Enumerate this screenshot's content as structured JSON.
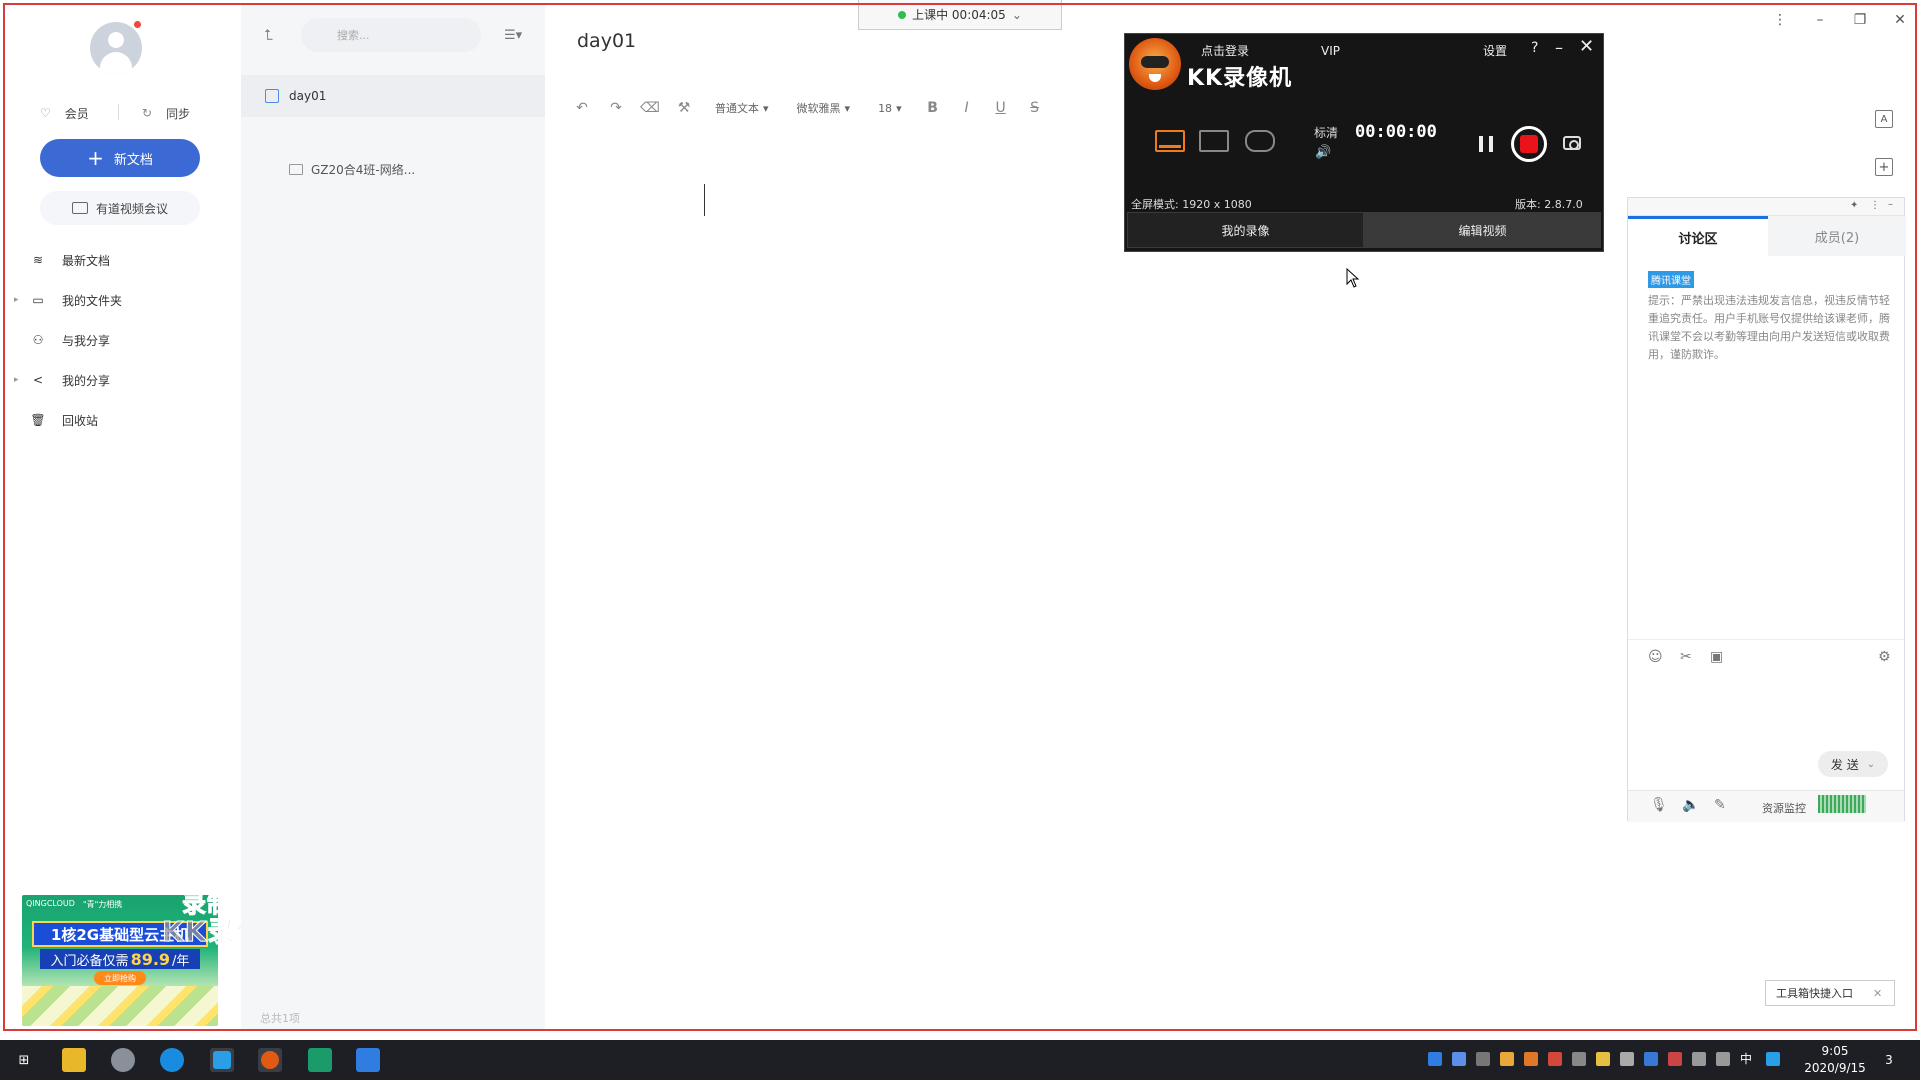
{
  "sidebar": {
    "member_label": "会员",
    "sync_label": "同步",
    "new_doc_label": "新文档",
    "meeting_label": "有道视频会议",
    "nav": [
      {
        "label": "最新文档",
        "icon": "layers-icon",
        "expandable": false
      },
      {
        "label": "我的文件夹",
        "icon": "folder-icon",
        "expandable": true
      },
      {
        "label": "与我分享",
        "icon": "user-share-icon",
        "expandable": false
      },
      {
        "label": "我的分享",
        "icon": "share-icon",
        "expandable": true
      },
      {
        "label": "回收站",
        "icon": "trash-icon",
        "expandable": false
      }
    ],
    "ad": {
      "top_left": "QINGCLOUD",
      "top_mid": "\"青\"力相携",
      "headline": "1核2G基础型云主机",
      "price_prefix": "入门必备仅需",
      "price": "89.9",
      "price_suffix": "/年",
      "button": "立即抢购"
    },
    "watermark_line1": "录制工具",
    "watermark_line2": "KK录像机"
  },
  "filelist": {
    "search_placeholder": "搜索...",
    "items": [
      {
        "name": "day01",
        "type": "doc"
      },
      {
        "name": "GZ20合4班-网络...",
        "type": "folder"
      }
    ],
    "count": "总共1项"
  },
  "editor": {
    "title": "day01",
    "style_dropdown": "普通文本",
    "font_dropdown": "微软雅黑",
    "size_dropdown": "18"
  },
  "class_status": {
    "label": "上课中 00:04:05"
  },
  "kk_recorder": {
    "login": "点击登录",
    "vip": "VIP",
    "brand": "KK录像机",
    "settings": "设置",
    "help": "?",
    "quality": "标清",
    "timer": "00:00:00",
    "fullscreen_mode": "全屏模式: 1920 x 1080",
    "version": "版本: 2.8.7.0",
    "tab_recordings": "我的录像",
    "tab_edit": "编辑视频",
    "accent": "#f07b1a",
    "record_color": "#e8141a"
  },
  "chat": {
    "tab_discussion": "讨论区",
    "tab_members": "成员(2)",
    "badge": "腾讯课堂",
    "notice": "提示：严禁出现违法违规发言信息，视违反情节轻重追究责任。用户手机账号仅提供给该课老师，腾讯课堂不会以考勤等理由向用户发送短信或收取费用，谨防欺诈。",
    "send_label": "发 送",
    "resource_monitor": "资源监控"
  },
  "toolbox": {
    "label": "工具箱快捷入口"
  },
  "taskbar": {
    "time": "9:05",
    "date": "2020/9/15",
    "ime": "中",
    "notifications": "3"
  }
}
